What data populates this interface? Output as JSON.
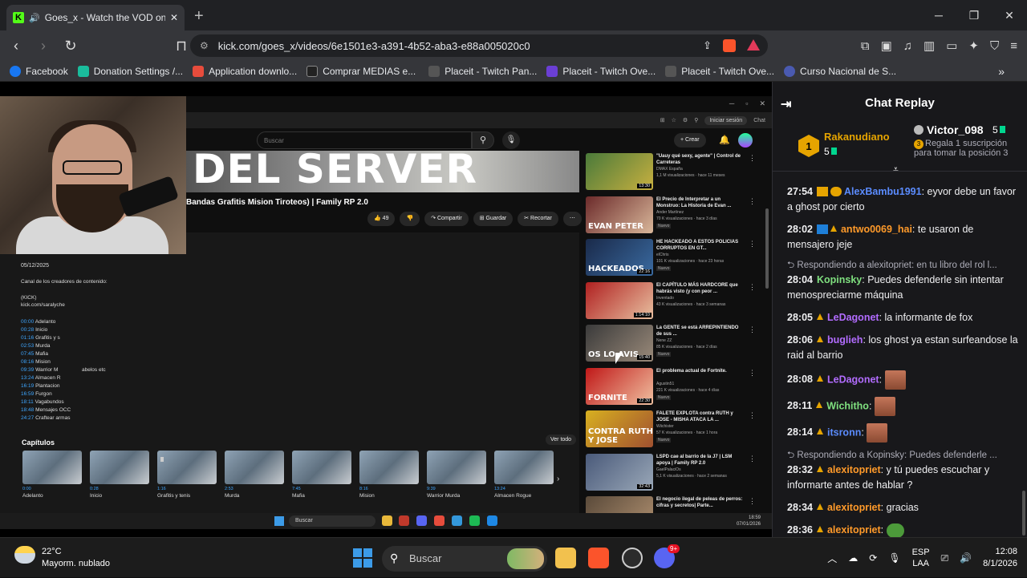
{
  "browser": {
    "tab_title": "Goes_x - Watch the VOD on K",
    "url": "kick.com/goes_x/videos/6e1501e3-a391-4b52-aba3-e88a005020c0",
    "bookmarks": [
      "Facebook",
      "Donation Settings /...",
      "Application downlo...",
      "Comprar MEDIAS e...",
      "Placeit - Twitch Pan...",
      "Placeit - Twitch Ove...",
      "Placeit - Twitch Ove...",
      "Curso Nacional de S..."
    ]
  },
  "video": {
    "youtube": {
      "search_placeholder": "Buscar",
      "create_label": "+ Crear",
      "banner_text": "DEL SERVER",
      "title": "Bandas Grafitis Mision Tiroteos) | Family RP 2.0",
      "likes": "49",
      "share": "Compartir",
      "save": "Guardar",
      "clip": "Recortar",
      "inner_login": "Iniciar sesión",
      "inner_chat": "Chat",
      "desc_date": "05/12/2025",
      "desc_lines": [
        "Canal de los creadores de contenido:",
        "(KICK)",
        "kick.com/saralyche"
      ],
      "chapters_list": [
        {
          "t": "00:00",
          "l": "Adelanto"
        },
        {
          "t": "00:28",
          "l": "Inicio"
        },
        {
          "t": "01:16",
          "l": "Grafitis y s"
        },
        {
          "t": "02:53",
          "l": "Murda"
        },
        {
          "t": "07:45",
          "l": "Mafia"
        },
        {
          "t": "08:16",
          "l": "Mision"
        },
        {
          "t": "09:39",
          "l": "Warrior M"
        },
        {
          "t": "13:24",
          "l": "Almacen R"
        },
        {
          "t": "16:19",
          "l": "Plantacion"
        },
        {
          "t": "16:59",
          "l": "Furgon"
        },
        {
          "t": "18:11",
          "l": "Vagabundos"
        },
        {
          "t": "18:48",
          "l": "Mensajes OCC"
        },
        {
          "t": "24:27",
          "l": "Craftear armas"
        }
      ],
      "desc_extra": "abelos etc",
      "chapters_title": "Capítulos",
      "ver_todo": "Ver todo",
      "chapter_thumbs": [
        {
          "t": "0:00",
          "l": "Adelanto"
        },
        {
          "t": "0:28",
          "l": "Inicio"
        },
        {
          "t": "1:16",
          "l": "Grafitis y tenis"
        },
        {
          "t": "2:53",
          "l": "Murda"
        },
        {
          "t": "7:45",
          "l": "Mafia"
        },
        {
          "t": "8:16",
          "l": "Mision"
        },
        {
          "t": "9:39",
          "l": "Warrior Murda"
        },
        {
          "t": "13:24",
          "l": "Almacen Rogue"
        }
      ],
      "recs": [
        {
          "title": "\"Uauy qué sexy, agente\" | Control de Carreteras",
          "channel": "DMAX España",
          "meta": "1,1 M visualizaciones · hace 11 meses",
          "dur": "13:30",
          "thumb": "",
          "c1": "#4a7a3a",
          "c2": "#c8b040",
          "new": ""
        },
        {
          "title": "El Precio de Interpretar a un Monstruo: La Historia de Evan ...",
          "channel": "Ander Martínez",
          "meta": "70 K visualizaciones · hace 3 días",
          "dur": "",
          "thumb": "EVAN PETER",
          "c1": "#6b2a2a",
          "c2": "#d9b79a",
          "new": "Nuevo"
        },
        {
          "title": "HE HACKEADO A ESTOS POLICIAS CORRUPTOS EN GT...",
          "channel": "elChris",
          "meta": "101 K visualizaciones · hace 23 horas",
          "dur": "22:16",
          "thumb": "HACKEADOS",
          "c1": "#1a2a4a",
          "c2": "#3a6aa0",
          "new": "Nuevo"
        },
        {
          "title": "El CAPÍTULO MÁS HARDCORE que habrás visto (y con peor ...",
          "channel": "Inventado",
          "meta": "43 K visualizaciones · hace 3 semanas",
          "dur": "1:14:10",
          "thumb": "",
          "c1": "#b02020",
          "c2": "#e8c0a0",
          "new": ""
        },
        {
          "title": "La GENTE se está ARREPINTIENDO de sus ...",
          "channel": "Nene ZZ",
          "meta": "85 K visualizaciones · hace 2 días",
          "dur": "15:40",
          "thumb": "OS LO AVIS",
          "c1": "#3a3a3a",
          "c2": "#9a8a7a",
          "new": "Nuevo"
        },
        {
          "title": "El problema actual de Fortnite.",
          "channel": "Agustin51",
          "meta": "221 K visualizaciones · hace 4 días",
          "dur": "22:30",
          "thumb": "FORNITE",
          "c1": "#c01818",
          "c2": "#f0c0a0",
          "new": "Nuevo"
        },
        {
          "title": "FALETE EXPLOTA contra RUTH y JOSE - MISHA ATACA LA ...",
          "channel": "Wiichister",
          "meta": "57 K visualizaciones · hace 1 hora",
          "dur": "",
          "thumb": "CONTRA RUTH Y JOSE",
          "c1": "#d8b020",
          "c2": "#a05030",
          "new": "Nuevo"
        },
        {
          "title": "LSPD cae al barrio de la J7 | LSM apoya | Family RP 2.0",
          "channel": "GaelPalaciOs",
          "meta": "5,1 K visualizaciones · hace 2 semanas",
          "dur": "32:43",
          "thumb": "",
          "c1": "#4a5a7a",
          "c2": "#9aa8b8",
          "new": ""
        },
        {
          "title": "El negocio ilegal de peleas de perros: cifras y secretos| Parte...",
          "channel": "",
          "meta": "",
          "dur": "",
          "thumb": "",
          "c1": "#5a4a3a",
          "c2": "#b09070",
          "new": ""
        }
      ],
      "taskbar_search": "Buscar",
      "inner_time": "18:59",
      "inner_date": "07/01/2026"
    }
  },
  "chat": {
    "title": "Chat Replay",
    "pinned": [
      {
        "rank": "1",
        "name": "Rakanudiano",
        "value": "5"
      },
      {
        "rank": "",
        "name": "Victor_098",
        "value": "5",
        "sub": "Regala 1 suscripción para tomar la posición 3",
        "subrank": "3"
      }
    ],
    "messages": [
      {
        "ts": "27:54",
        "user": "AlexBambu1991",
        "color": "#5b8cff",
        "text": "eyvor debe un favor a ghost por cierto",
        "reply": "",
        "emote": ""
      },
      {
        "ts": "28:02",
        "user": "antwo0069_hai",
        "color": "#ff9a2a",
        "text": "te usaron de mensajero jeje",
        "reply": "",
        "emote": ""
      },
      {
        "ts": "28:04",
        "user": "Kopinsky",
        "color": "#7fe07f",
        "text": "Puedes defenderle sin intentar menospreciarme máquina",
        "reply": "Respondiendo a alexitopriet: en tu libro del rol l...",
        "emote": ""
      },
      {
        "ts": "28:05",
        "user": "LeDagonet",
        "color": "#b26cff",
        "text": "la informante de fox",
        "reply": "",
        "emote": ""
      },
      {
        "ts": "28:06",
        "user": "buglieh",
        "color": "#b26cff",
        "text": "los ghost ya estan surfeandose la raid al barrio",
        "reply": "",
        "emote": ""
      },
      {
        "ts": "28:08",
        "user": "LeDagonet",
        "color": "#b26cff",
        "text": "",
        "reply": "",
        "emote": "face"
      },
      {
        "ts": "28:11",
        "user": "Wichitho",
        "color": "#7fe07f",
        "text": "",
        "reply": "",
        "emote": "face"
      },
      {
        "ts": "28:14",
        "user": "itsronn",
        "color": "#5b8cff",
        "text": "",
        "reply": "",
        "emote": "face"
      },
      {
        "ts": "28:32",
        "user": "alexitopriet",
        "color": "#ff9a2a",
        "text": "y tú puedes escuchar y informarte antes de hablar ?",
        "reply": "Respondiendo a Kopinsky: Puedes defenderle ...",
        "emote": ""
      },
      {
        "ts": "28:34",
        "user": "alexitopriet",
        "color": "#ff9a2a",
        "text": "gracias",
        "reply": "",
        "emote": ""
      },
      {
        "ts": "28:36",
        "user": "alexitopriet",
        "color": "#ff9a2a",
        "text": "",
        "reply": "",
        "emote": "pepe"
      }
    ]
  },
  "taskbar": {
    "temp": "22°C",
    "weather": "Mayorm. nublado",
    "search": "Buscar",
    "lang1": "ESP",
    "lang2": "LAA",
    "time": "12:08",
    "date": "8/1/2026",
    "badge": "9+"
  }
}
